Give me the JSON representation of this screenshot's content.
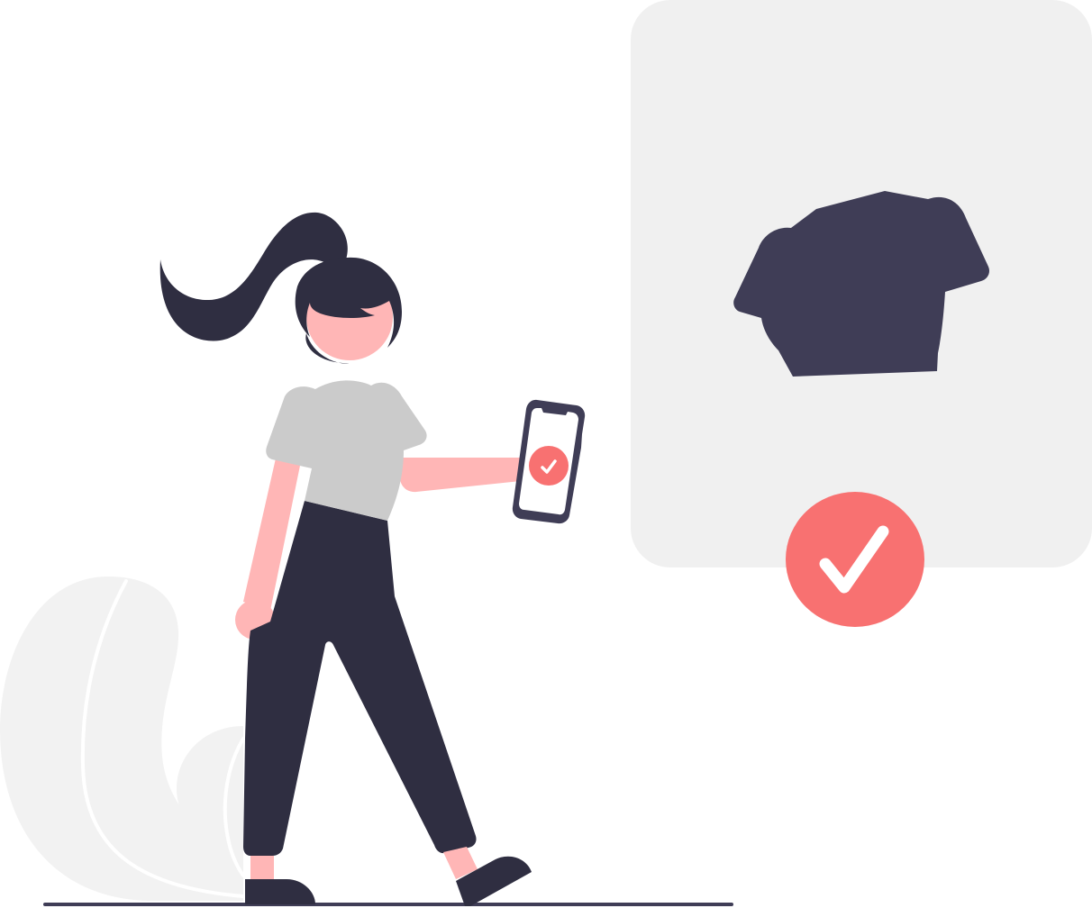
{
  "illustration": {
    "colors": {
      "background": "#ffffff",
      "panel": "#f0f0f0",
      "plant": "#f2f2f2",
      "plant_stem": "#ffffff",
      "dark": "#2f2e41",
      "shirt_dark": "#3f3d56",
      "skin": "#ffb6b6",
      "shirt_light": "#cbcbcb",
      "accent": "#f87171",
      "check": "#ffffff",
      "phone_screen": "#ffffff",
      "ground": "#3f3d56"
    },
    "icons": {
      "big_check": "check-circle-icon",
      "phone_check": "check-circle-icon",
      "product": "tshirt-icon"
    }
  }
}
